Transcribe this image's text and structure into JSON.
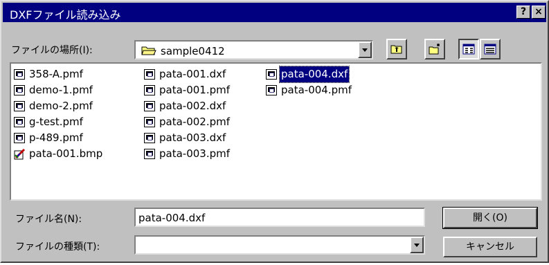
{
  "window": {
    "title": "DXFファイル読み込み",
    "help_label": "?",
    "close_label": "×"
  },
  "location": {
    "label": "ファイルの場所(I):",
    "value": "sample0412"
  },
  "toolbar": {
    "icons": [
      "folder-up-icon",
      "new-folder-icon",
      "list-view-icon",
      "details-view-icon"
    ]
  },
  "files": {
    "columns": [
      [
        {
          "name": "358-A.pmf",
          "icon": "document-icon"
        },
        {
          "name": "demo-1.pmf",
          "icon": "document-icon"
        },
        {
          "name": "demo-2.pmf",
          "icon": "document-icon"
        },
        {
          "name": "g-test.pmf",
          "icon": "document-icon"
        },
        {
          "name": "p-489.pmf",
          "icon": "document-icon"
        },
        {
          "name": "pata-001.bmp",
          "icon": "paint-icon"
        }
      ],
      [
        {
          "name": "pata-001.dxf",
          "icon": "document-icon"
        },
        {
          "name": "pata-001.pmf",
          "icon": "document-icon"
        },
        {
          "name": "pata-002.dxf",
          "icon": "document-icon"
        },
        {
          "name": "pata-002.pmf",
          "icon": "document-icon"
        },
        {
          "name": "pata-003.dxf",
          "icon": "document-icon"
        },
        {
          "name": "pata-003.pmf",
          "icon": "document-icon"
        }
      ],
      [
        {
          "name": "pata-004.dxf",
          "icon": "document-icon",
          "selected": true
        },
        {
          "name": "pata-004.pmf",
          "icon": "document-icon"
        }
      ]
    ]
  },
  "filename": {
    "label": "ファイル名(N):",
    "value": "pata-004.dxf"
  },
  "filetype": {
    "label": "ファイルの種類(T):",
    "value": ""
  },
  "buttons": {
    "open": "開く(O)",
    "cancel": "キャンセル"
  },
  "colors": {
    "title_bar": "#000080",
    "dialog_face": "#c0c0c0",
    "selection": "#000080"
  }
}
